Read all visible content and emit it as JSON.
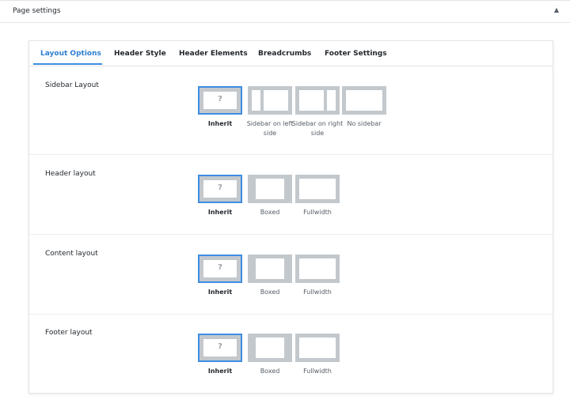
{
  "metabox": {
    "title": "Page settings",
    "toggle_icon": "caret-up-icon"
  },
  "tabs": [
    {
      "label": "Layout Options",
      "active": true
    },
    {
      "label": "Header Style",
      "active": false
    },
    {
      "label": "Header Elements",
      "active": false
    },
    {
      "label": "Breadcrumbs",
      "active": false
    },
    {
      "label": "Footer Settings",
      "active": false
    }
  ],
  "sections": {
    "sidebar_layout": {
      "label": "Sidebar Layout",
      "options": [
        {
          "label": "Inherit",
          "icon": "inherit-layout-icon",
          "selected": true
        },
        {
          "label": "Sidebar on left side",
          "icon": "sidebar-left-layout-icon",
          "selected": false
        },
        {
          "label": "Sidebar on right side",
          "icon": "sidebar-right-layout-icon",
          "selected": false
        },
        {
          "label": "No sidebar",
          "icon": "no-sidebar-layout-icon",
          "selected": false
        }
      ]
    },
    "header_layout": {
      "label": "Header layout",
      "options": [
        {
          "label": "Inherit",
          "icon": "inherit-layout-icon",
          "selected": true
        },
        {
          "label": "Boxed",
          "icon": "boxed-layout-icon",
          "selected": false
        },
        {
          "label": "Fullwidth",
          "icon": "fullwidth-layout-icon",
          "selected": false
        }
      ]
    },
    "content_layout": {
      "label": "Content layout",
      "options": [
        {
          "label": "Inherit",
          "icon": "inherit-layout-icon",
          "selected": true
        },
        {
          "label": "Boxed",
          "icon": "boxed-layout-icon",
          "selected": false
        },
        {
          "label": "Fullwidth",
          "icon": "fullwidth-layout-icon",
          "selected": false
        }
      ]
    },
    "footer_layout": {
      "label": "Footer layout",
      "options": [
        {
          "label": "Inherit",
          "icon": "inherit-layout-icon",
          "selected": true
        },
        {
          "label": "Boxed",
          "icon": "boxed-layout-icon",
          "selected": false
        },
        {
          "label": "Fullwidth",
          "icon": "fullwidth-layout-icon",
          "selected": false
        }
      ]
    }
  },
  "inherit_glyph": "?",
  "colors": {
    "accent": "#3d8de3",
    "thumb_gray": "#c3c8cd"
  }
}
